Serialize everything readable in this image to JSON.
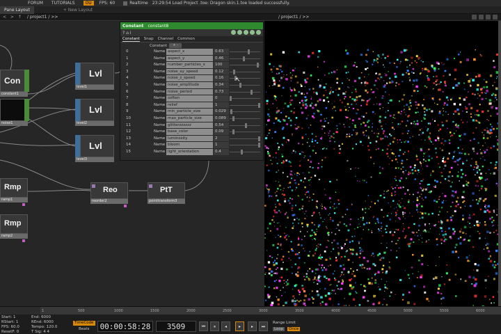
{
  "topbar": {
    "forum": "FORUM",
    "tutorials": "TUTORIALS",
    "badge": "OU",
    "fps_label": "FPS:",
    "fps_value": "60",
    "realtime": "Realtime",
    "message": "23:29:54 Load Project .toe: Dragon skin.1.toe loaded successfully."
  },
  "tabs": {
    "pane_layout": "Pane Layout",
    "new_layout": "+ New Layout"
  },
  "path": {
    "arrows": "< > ↑",
    "project": "/ project1 / >>",
    "viewer_project": "/ project1 / >>"
  },
  "nodes": {
    "con": {
      "title": "Con",
      "label": "constant1"
    },
    "noise": {
      "label": "noise1"
    },
    "lvl1": {
      "title": "Lvl",
      "label": "level1"
    },
    "lvl2": {
      "title": "Lvl",
      "label": "level2"
    },
    "lvl3": {
      "title": "Lvl",
      "label": "level3"
    },
    "rmp1": {
      "title": "Rmp",
      "label": "ramp1"
    },
    "rmp2": {
      "title": "Rmp",
      "label": "ramp2"
    },
    "reo": {
      "title": "Reo",
      "label": "reorder2"
    },
    "ptt": {
      "title": "PtT",
      "label": "pointtransform3"
    }
  },
  "dialog": {
    "type": "Constant",
    "name": "constant8",
    "tabs": [
      "Constant",
      "Snap",
      "Channel",
      "Common"
    ],
    "constant_label": "Constant",
    "constant_btn": "+ -",
    "name_label": "Name",
    "params": [
      {
        "idx": "0",
        "name": "aspect_x",
        "value": "0.63",
        "level": 0.63
      },
      {
        "idx": "1",
        "name": "aspect_y",
        "value": "0.46",
        "level": 0.46
      },
      {
        "idx": "2",
        "name": "number_particles_x",
        "value": "100",
        "level": 0.95
      },
      {
        "idx": "3",
        "name": "noise_xy_speed",
        "value": "0.12",
        "level": 0.12
      },
      {
        "idx": "4",
        "name": "noise_z_speed",
        "value": "0.16",
        "level": 0.16
      },
      {
        "idx": "5",
        "name": "noise_amplitude",
        "value": "0.34",
        "level": 0.34
      },
      {
        "idx": "6",
        "name": "noise_period",
        "value": "0.73",
        "level": 0.73
      },
      {
        "idx": "7",
        "name": "soften",
        "value": "0",
        "level": 0
      },
      {
        "idx": "8",
        "name": "relief",
        "value": "1",
        "level": 1
      },
      {
        "idx": "9",
        "name": "min_particle_size",
        "value": "0.029",
        "level": 0.03
      },
      {
        "idx": "10",
        "name": "max_particle_size",
        "value": "0.089",
        "level": 0.09
      },
      {
        "idx": "11",
        "name": "glitterzzzzzz",
        "value": "0.54",
        "level": 0.54
      },
      {
        "idx": "12",
        "name": "base_color",
        "value": "0.09",
        "level": 0.09
      },
      {
        "idx": "13",
        "name": "luminosity",
        "value": "2",
        "level": 1
      },
      {
        "idx": "14",
        "name": "bloom",
        "value": "1",
        "level": 1
      },
      {
        "idx": "15",
        "name": "light_orientation",
        "value": "0.4",
        "level": 0.4
      }
    ]
  },
  "ruler": {
    "ticks": [
      "1",
      "500",
      "1000",
      "1500",
      "2000",
      "2500",
      "3000",
      "3500",
      "4000",
      "4500",
      "5000",
      "5500",
      "6000"
    ]
  },
  "bottom": {
    "start_label": "Start:",
    "start_value": "1",
    "end_label": "End:",
    "end_value": "6000",
    "rstart_label": "RStart:",
    "rstart_value": "1",
    "rend_label": "REnd:",
    "rend_value": "6000",
    "fps_label": "FPS:",
    "fps_value": "60.0",
    "tempo_label": "Tempo:",
    "tempo_value": "120.0",
    "resetf_label": "ResetF:",
    "resetf_value": "0",
    "tsig_label": "T Sig:",
    "tsig_value": "4 4",
    "timecode_btn": "TimeCode",
    "beats_btn": "Beats",
    "timecode": "00:00:58:28",
    "frame": "3509",
    "range_limit": "Range Limit",
    "loop": "Loop",
    "once": "Once"
  },
  "colors": {
    "dialog_header": "#2f8a2f",
    "accent": "#d98a00",
    "node_side": "#3c6f99"
  }
}
